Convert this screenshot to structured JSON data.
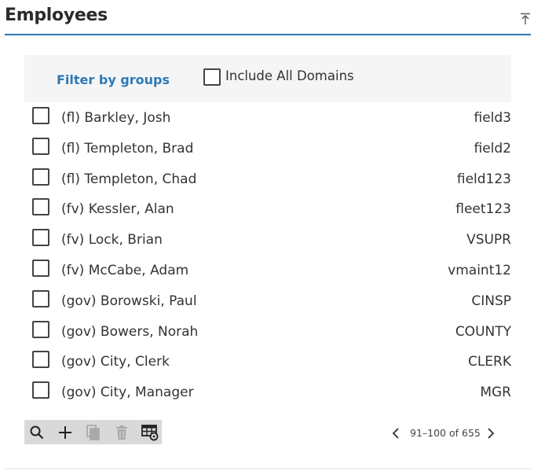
{
  "header": {
    "title": "Employees"
  },
  "filter": {
    "link_label": "Filter by groups",
    "include_all_label": "Include All Domains",
    "include_all_checked": false
  },
  "employees": [
    {
      "name": "(fl) Barkley, Josh",
      "code": "field3",
      "checked": false
    },
    {
      "name": "(fl) Templeton, Brad",
      "code": "field2",
      "checked": false
    },
    {
      "name": "(fl) Templeton, Chad",
      "code": "field123",
      "checked": false
    },
    {
      "name": "(fv) Kessler, Alan",
      "code": "fleet123",
      "checked": false
    },
    {
      "name": "(fv) Lock, Brian",
      "code": "VSUPR",
      "checked": false
    },
    {
      "name": "(fv) McCabe, Adam",
      "code": "vmaint12",
      "checked": false
    },
    {
      "name": "(gov) Borowski, Paul",
      "code": "CINSP",
      "checked": false
    },
    {
      "name": "(gov) Bowers, Norah",
      "code": "COUNTY",
      "checked": false
    },
    {
      "name": "(gov) City, Clerk",
      "code": "CLERK",
      "checked": false
    },
    {
      "name": "(gov) City, Manager",
      "code": "MGR",
      "checked": false
    }
  ],
  "toolbar": {
    "icons": [
      "search-icon",
      "plus-icon",
      "copy-icon",
      "trash-icon",
      "table-settings-icon"
    ],
    "disabled": [
      "copy-icon",
      "trash-icon"
    ]
  },
  "pager": {
    "range_label": "91–100 of 655"
  },
  "colors": {
    "accent": "#2e79b5",
    "toolbar_bg": "#d9d9d9",
    "filter_bg": "#f5f5f5"
  }
}
